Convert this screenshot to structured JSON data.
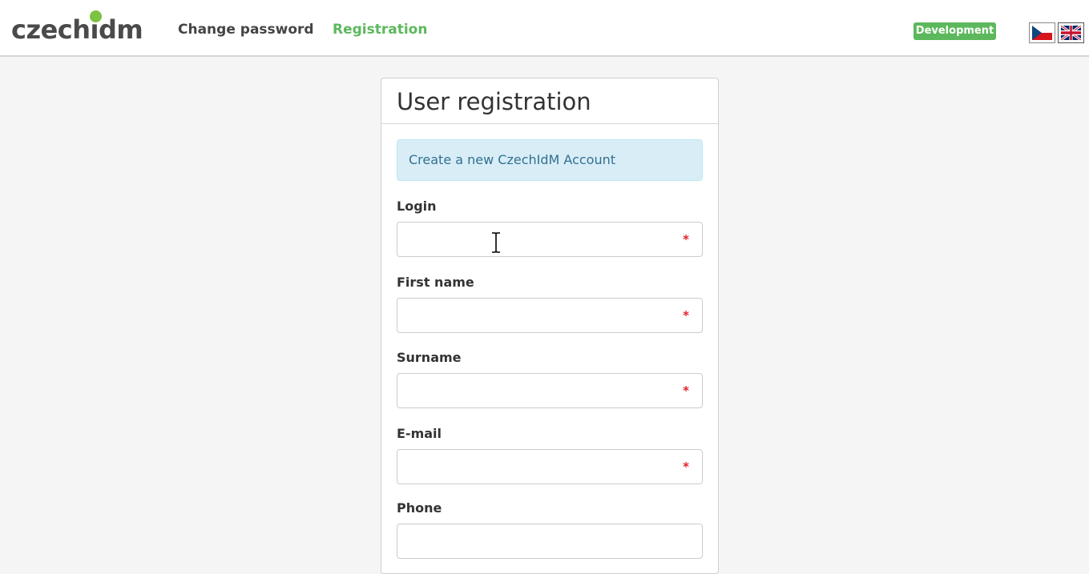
{
  "brand": {
    "prefix": "czech",
    "i": "ı",
    "suffix": "dm"
  },
  "nav": {
    "change_password": "Change password",
    "registration": "Registration"
  },
  "environment_badge": "Development",
  "languages": [
    "cs",
    "en"
  ],
  "colors": {
    "accent_green": "#5cb85c",
    "logo_dot": "#7cc243",
    "info_bg": "#d9edf7",
    "info_text": "#31708f",
    "required": "#e2232a"
  },
  "form": {
    "title": "User registration",
    "info": "Create a new CzechIdM Account",
    "fields": [
      {
        "label": "Login",
        "value": "",
        "required": "*"
      },
      {
        "label": "First name",
        "value": "",
        "required": "*"
      },
      {
        "label": "Surname",
        "value": "",
        "required": "*"
      },
      {
        "label": "E-mail",
        "value": "",
        "required": "*"
      },
      {
        "label": "Phone",
        "value": ""
      }
    ]
  }
}
